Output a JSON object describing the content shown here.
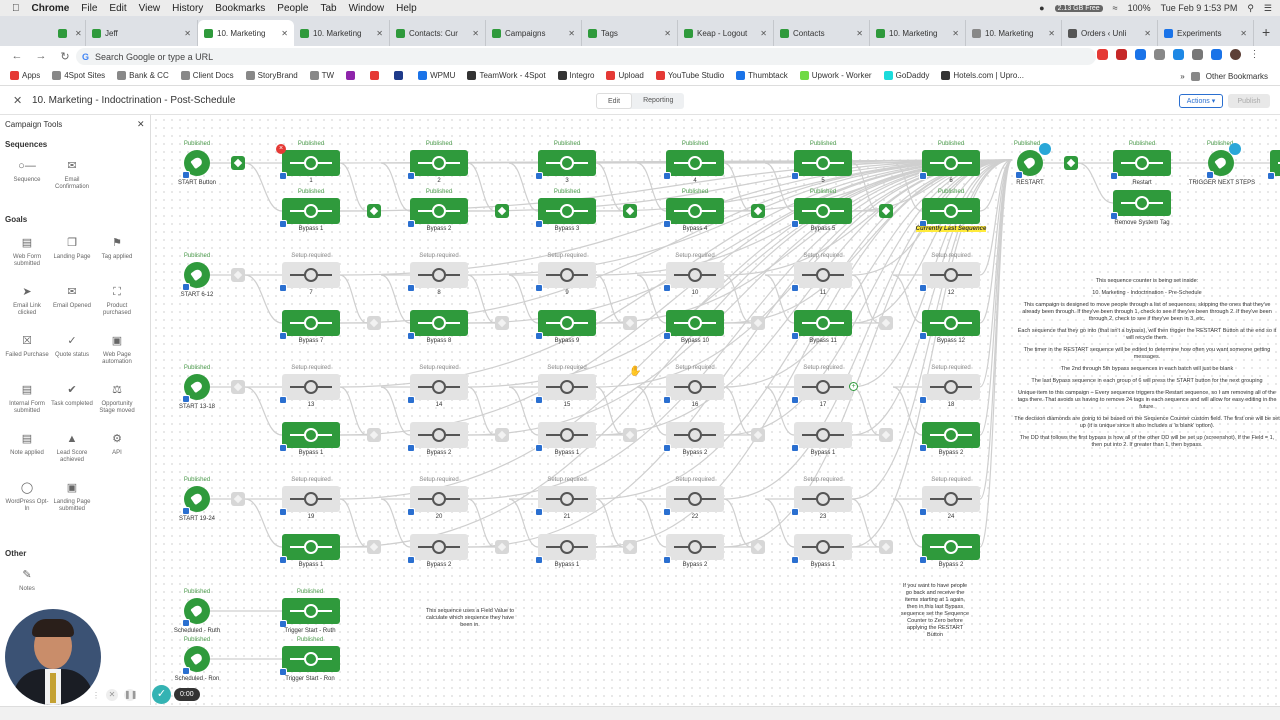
{
  "macbar": {
    "app": "Chrome",
    "menus": [
      "File",
      "Edit",
      "View",
      "History",
      "Bookmarks",
      "People",
      "Tab",
      "Window",
      "Help"
    ],
    "disk": "2.13 GB Free",
    "battery": "100%",
    "datetime": "Tue Feb 9  1:53 PM"
  },
  "tabs": [
    {
      "label": "",
      "color": "#2f9a3c"
    },
    {
      "label": "Jeff",
      "color": "#2f9a3c"
    },
    {
      "label": "10. Marketing",
      "color": "#2f9a3c",
      "active": true
    },
    {
      "label": "10. Marketing",
      "color": "#2f9a3c"
    },
    {
      "label": "Contacts: Cur",
      "color": "#2f9a3c"
    },
    {
      "label": "Campaigns",
      "color": "#2f9a3c"
    },
    {
      "label": "Tags",
      "color": "#2f9a3c"
    },
    {
      "label": "Keap - Logout",
      "color": "#2f9a3c"
    },
    {
      "label": "Contacts",
      "color": "#2f9a3c"
    },
    {
      "label": "10. Marketing",
      "color": "#2f9a3c"
    },
    {
      "label": "10. Marketing",
      "color": "#888"
    },
    {
      "label": "Orders ‹ Unli",
      "color": "#555"
    },
    {
      "label": "Experiments",
      "color": "#1a73e8"
    }
  ],
  "omnibox": {
    "placeholder": "Search Google or type a URL"
  },
  "bookmarks": [
    {
      "label": "Apps",
      "color": "#e53935"
    },
    {
      "label": "4Spot Sites",
      "color": "#888"
    },
    {
      "label": "Bank & CC",
      "color": "#888"
    },
    {
      "label": "Client Docs",
      "color": "#888"
    },
    {
      "label": "StoryBrand",
      "color": "#888"
    },
    {
      "label": "TW",
      "color": "#888"
    },
    {
      "label": "",
      "color": "#8e24aa"
    },
    {
      "label": "",
      "color": "#e53935"
    },
    {
      "label": "",
      "color": "#1e3a8a"
    },
    {
      "label": "WPMU",
      "color": "#1a73e8"
    },
    {
      "label": "TeamWork - 4Spot",
      "color": "#333"
    },
    {
      "label": "Integro",
      "color": "#333"
    },
    {
      "label": "Upload",
      "color": "#e53935"
    },
    {
      "label": "YouTube Studio",
      "color": "#e53935"
    },
    {
      "label": "Thumbtack",
      "color": "#1a73e8"
    },
    {
      "label": "Upwork - Worker",
      "color": "#6fda44"
    },
    {
      "label": "GoDaddy",
      "color": "#1bdbdb"
    },
    {
      "label": "Hotels.com | Upro...",
      "color": "#333"
    }
  ],
  "bookmarks_other": "Other Bookmarks",
  "app": {
    "title": "10. Marketing - Indoctrination - Post-Schedule",
    "tab_edit": "Edit",
    "tab_reporting": "Reporting",
    "actions": "Actions",
    "publish": "Publish"
  },
  "sidebar": {
    "title": "Campaign Tools",
    "sequences_heading": "Sequences",
    "goals_heading": "Goals",
    "other_heading": "Other",
    "sequences": [
      {
        "label": "Sequence",
        "icon": "sequence-icon"
      },
      {
        "label": "Email Confirmation",
        "icon": "email-confirmation-icon"
      }
    ],
    "goals": [
      {
        "label": "Web Form submitted",
        "icon": "web-form-icon"
      },
      {
        "label": "Landing Page",
        "icon": "landing-page-icon"
      },
      {
        "label": "Tag applied",
        "icon": "tag-icon"
      },
      {
        "label": "Email Link clicked",
        "icon": "cursor-icon"
      },
      {
        "label": "Email Opened",
        "icon": "envelope-icon"
      },
      {
        "label": "Product purchased",
        "icon": "cart-icon"
      },
      {
        "label": "Failed Purchase",
        "icon": "failed-purchase-icon"
      },
      {
        "label": "Quote status",
        "icon": "quote-icon"
      },
      {
        "label": "Web Page automation",
        "icon": "web-page-icon"
      },
      {
        "label": "Internal Form submitted",
        "icon": "internal-form-icon"
      },
      {
        "label": "Task completed",
        "icon": "task-icon"
      },
      {
        "label": "Opportunity Stage moved",
        "icon": "opportunity-icon"
      },
      {
        "label": "Note applied",
        "icon": "note-icon"
      },
      {
        "label": "Lead Score achieved",
        "icon": "lead-score-icon"
      },
      {
        "label": "API",
        "icon": "api-icon"
      },
      {
        "label": "WordPress Opt-In",
        "icon": "wordpress-icon"
      },
      {
        "label": "Landing Page submitted",
        "icon": "landing-page-submitted-icon"
      }
    ],
    "other": [
      {
        "label": "Notes",
        "icon": "pencil-icon"
      }
    ]
  },
  "canvas": {
    "status_published": "Published",
    "status_setup": "Setup required",
    "rows": [
      {
        "start": "START Button",
        "seq": [
          "1",
          "2",
          "3",
          "4",
          "5",
          "6"
        ],
        "bypass": [
          "Bypass 1",
          "Bypass 2",
          "Bypass 3",
          "Bypass 4",
          "Bypass 5",
          "Currently Last Sequence"
        ]
      },
      {
        "start": "START 6-12",
        "seq": [
          "7",
          "8",
          "9",
          "10",
          "11",
          "12"
        ],
        "bypass": [
          "Bypass 7",
          "Bypass 8",
          "Bypass 9",
          "Bypass 10",
          "Bypass 11",
          "Bypass 12"
        ]
      },
      {
        "start": "START 13-18",
        "seq": [
          "13",
          "14",
          "15",
          "16",
          "17",
          "18"
        ],
        "bypass": [
          "Bypass 1",
          "Bypass 2",
          "Bypass 1",
          "Bypass 2",
          "Bypass 1",
          "Bypass 2"
        ]
      },
      {
        "start": "START 19-24",
        "seq": [
          "19",
          "20",
          "21",
          "22",
          "23",
          "24"
        ],
        "bypass": [
          "Bypass 1",
          "Bypass 2",
          "Bypass 1",
          "Bypass 2",
          "Bypass 1",
          "Bypass 2"
        ]
      }
    ],
    "restart": "RESTART",
    "restart_seq": "Restart",
    "remove_tag": "Remove System Tag",
    "trigger_next": "TRIGGER NEXT STEPS",
    "scheduled_ruth": "Scheduled - Ruth",
    "scheduled_ron": "Scheduled - Ron",
    "trigger_ruth": "Trigger Start - Ruth",
    "trigger_ron": "Trigger Start - Ron",
    "field_note": "This sequence uses a Field Value to calculate which sequence they have been in.",
    "bypass_note": "If you want to have people go back and receive the items starting at 1 again, then in this last Bypass sequence set the Sequence Counter to Zero before applying the RESTART Button",
    "info": [
      "This sequence counter is being set inside:",
      "10. Marketing - Indoctrination - Pre-Schedule",
      "This campaign is designed to move people through a list of sequences, skipping the ones that they've already been through.  If they've been through 1, check to see if they've been through 2.  If they've been through 2, check to see if they've been in 3, etc.",
      "Each sequence that they go into (that isn't a bypass), will then trigger the RESTART Button at the end so it will recycle them.",
      "The timer in the RESTART sequence will be edited to determine how often you want someone getting messages.",
      "The 2nd through 5th bypass sequences in each batch will just be blank",
      "The last Bypass sequence in each group of 6 will press the START button for the next grouping",
      "Unique item to this campaign – Every sequence triggers the Restart sequence, so I am removing all of the tags there.  That avoids us having to remove 24 tags in each sequence and will allow for easy editing in the future.",
      "The decision diamonds are going to be based on the Sequence Counter custom field.  The first one will be set up (it is unique since it also includes a 'is blank' option).",
      "The DD that follows the first bypass is how all of the other DD will be set up (screenshot).  If the Field = 1, then put into 2.  If greater than 1, then bypass."
    ]
  },
  "recorder": {
    "time": "0:00"
  }
}
